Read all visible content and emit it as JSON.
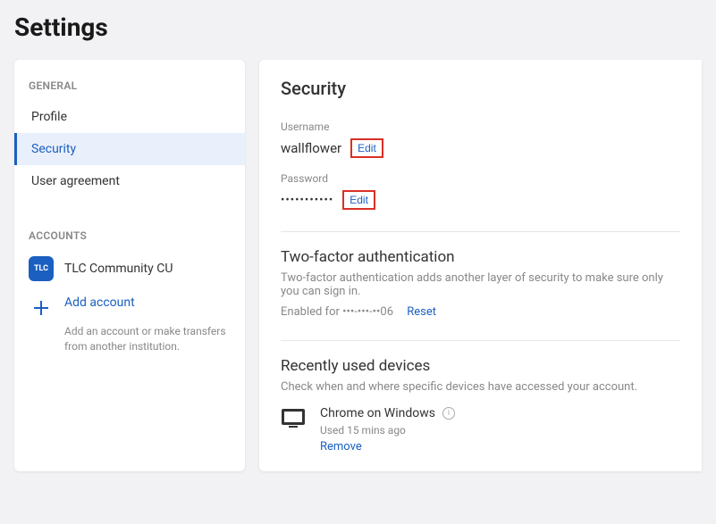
{
  "page": {
    "title": "Settings"
  },
  "sidebar": {
    "general_label": "GENERAL",
    "items": [
      {
        "label": "Profile"
      },
      {
        "label": "Security"
      },
      {
        "label": "User agreement"
      }
    ],
    "accounts_label": "ACCOUNTS",
    "account": {
      "logo_text": "TLC",
      "name": "TLC Community CU"
    },
    "add_account": {
      "label": "Add account",
      "sub": "Add an account or make transfers from another institution."
    }
  },
  "main": {
    "title": "Security",
    "username": {
      "label": "Username",
      "value": "wallflower",
      "edit": "Edit"
    },
    "password": {
      "label": "Password",
      "mask": "•••••••••••",
      "edit": "Edit"
    },
    "twofa": {
      "title": "Two-factor authentication",
      "desc": "Two-factor authentication adds another layer of security to make sure only you can sign in.",
      "enabled_text": "Enabled for •••-•••-••06",
      "reset": "Reset"
    },
    "devices": {
      "title": "Recently used devices",
      "desc": "Check when and where specific devices have accessed your account.",
      "list": [
        {
          "name": "Chrome on Windows",
          "time": "Used 15 mins ago",
          "remove": "Remove"
        }
      ]
    }
  }
}
